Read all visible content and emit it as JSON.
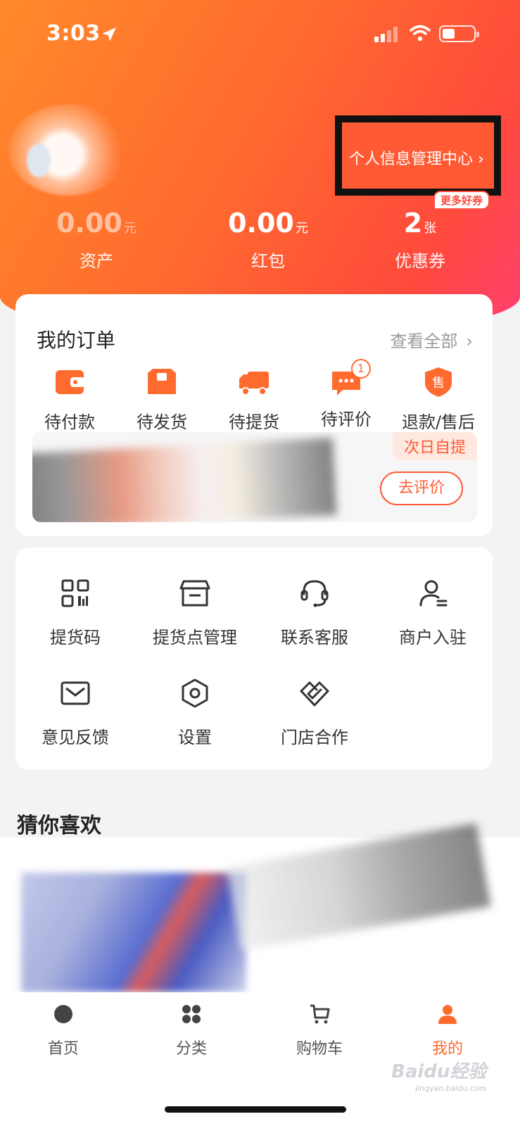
{
  "status_bar": {
    "time": "3:03"
  },
  "header": {
    "profile_link": "个人信息管理中心",
    "more_coupons": "更多好券",
    "stats": [
      {
        "value": "0.00",
        "unit": "元",
        "label": "资产"
      },
      {
        "value": "0.00",
        "unit": "元",
        "label": "红包"
      },
      {
        "value": "2",
        "unit": "张",
        "label": "优惠券"
      }
    ]
  },
  "orders": {
    "title": "我的订单",
    "view_all": "查看全部",
    "items": [
      {
        "label": "待付款",
        "icon": "wallet-icon"
      },
      {
        "label": "待发货",
        "icon": "box-icon"
      },
      {
        "label": "待提货",
        "icon": "truck-icon"
      },
      {
        "label": "待评价",
        "icon": "comment-icon",
        "badge": "1"
      },
      {
        "label": "退款/售后",
        "icon": "after-sale-icon"
      }
    ],
    "preview": {
      "tag": "次日自提",
      "button": "去评价"
    }
  },
  "services": [
    {
      "label": "提货码",
      "icon": "qr-code-icon"
    },
    {
      "label": "提货点管理",
      "icon": "store-icon"
    },
    {
      "label": "联系客服",
      "icon": "headset-icon"
    },
    {
      "label": "商户入驻",
      "icon": "merchant-icon"
    },
    {
      "label": "意见反馈",
      "icon": "mail-icon"
    },
    {
      "label": "设置",
      "icon": "settings-icon"
    },
    {
      "label": "门店合作",
      "icon": "handshake-icon"
    }
  ],
  "guess": {
    "title": "猜你喜欢"
  },
  "tabbar": [
    {
      "label": "首页",
      "icon": "home-icon"
    },
    {
      "label": "分类",
      "icon": "category-icon"
    },
    {
      "label": "购物车",
      "icon": "cart-icon"
    },
    {
      "label": "我的",
      "icon": "profile-icon",
      "active": true
    }
  ],
  "watermark": {
    "text": "Baidu经验",
    "sub": "jingyan.baidu.com"
  },
  "colors": {
    "accent": "#ff6a2f",
    "gradient_start": "#ff8a2a",
    "gradient_end": "#ff4070"
  }
}
